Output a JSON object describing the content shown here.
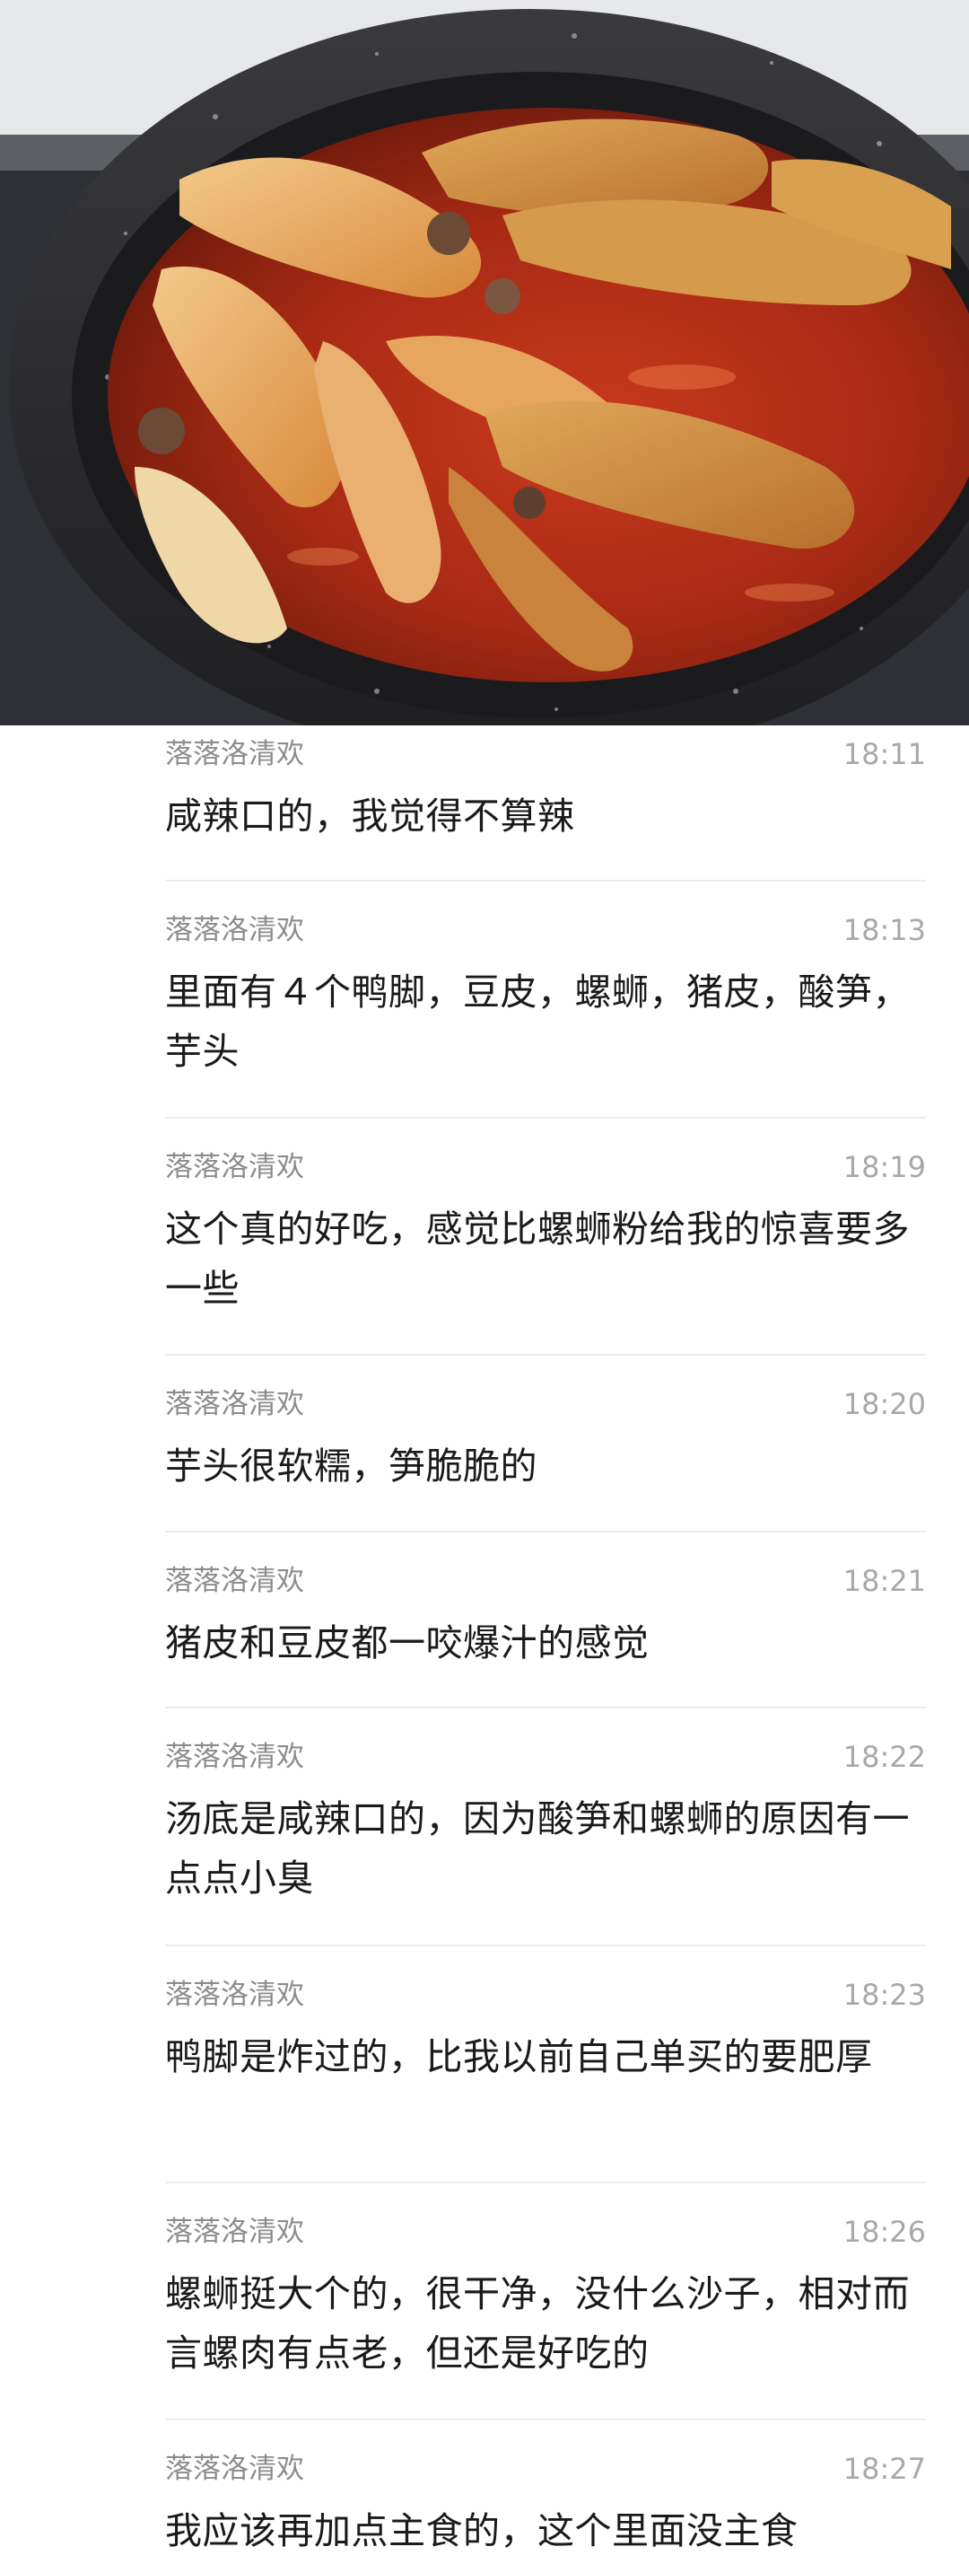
{
  "photo": {
    "icon": "hotpot-photo"
  },
  "messages": [
    {
      "sender": "落落洛清欢",
      "time": "18:11",
      "text": "咸辣口的，我觉得不算辣"
    },
    {
      "sender": "落落洛清欢",
      "time": "18:13",
      "text": "里面有４个鸭脚，豆皮，螺蛳，猪皮，酸笋，芋头"
    },
    {
      "sender": "落落洛清欢",
      "time": "18:19",
      "text": "这个真的好吃，感觉比螺蛳粉给我的惊喜要多一些"
    },
    {
      "sender": "落落洛清欢",
      "time": "18:20",
      "text": "芋头很软糯，笋脆脆的"
    },
    {
      "sender": "落落洛清欢",
      "time": "18:21",
      "text": "猪皮和豆皮都一咬爆汁的感觉"
    },
    {
      "sender": "落落洛清欢",
      "time": "18:22",
      "text": "汤底是咸辣口的，因为酸笋和螺蛳的原因有一点点小臭"
    },
    {
      "sender": "落落洛清欢",
      "time": "18:23",
      "text": "鸭脚是炸过的，比我以前自己单买的要肥厚"
    },
    {
      "sender": "落落洛清欢",
      "time": "18:26",
      "text": "螺蛳挺大个的，很干净，没什么沙子，相对而言螺肉有点老，但还是好吃的"
    },
    {
      "sender": "落落洛清欢",
      "time": "18:27",
      "text": "我应该再加点主食的，这个里面没主食"
    }
  ]
}
